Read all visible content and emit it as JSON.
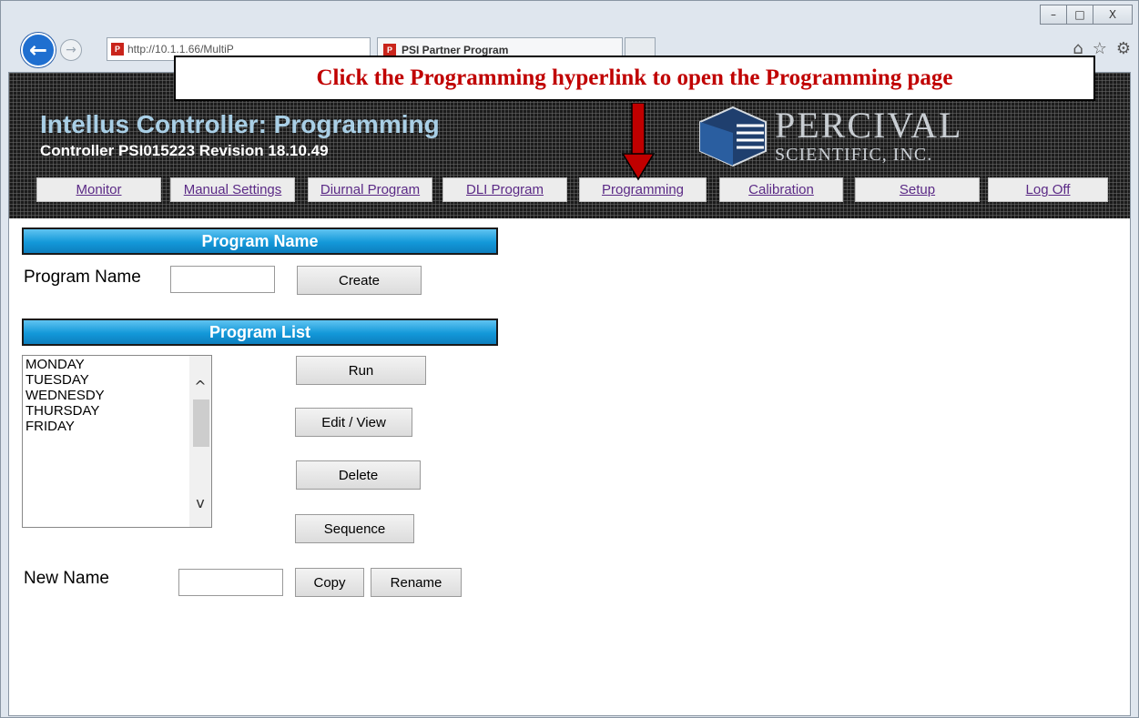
{
  "window": {
    "minimize": "–",
    "maximize": "□",
    "close": "X"
  },
  "browser": {
    "back_icon": "←",
    "forward_icon": "→",
    "address": "http://10.1.1.66/MultiP",
    "tab_title": "PSI Partner Program",
    "tool_icons": [
      "home-icon",
      "star-icon",
      "gear-icon"
    ]
  },
  "header": {
    "title": "Intellus Controller: Programming",
    "subtitle": "Controller PSI015223 Revision 18.10.49",
    "logo": {
      "line1": "PERCIVAL",
      "line2": "SCIENTIFIC, INC."
    }
  },
  "nav": [
    {
      "label": "Monitor"
    },
    {
      "label": "Manual Settings"
    },
    {
      "label": "Diurnal Program"
    },
    {
      "label": "DLI Program"
    },
    {
      "label": "Programming"
    },
    {
      "label": "Calibration"
    },
    {
      "label": "Setup"
    },
    {
      "label": "Log Off"
    }
  ],
  "callout": {
    "text": "Click the Programming hyperlink to open the Programming page",
    "color": "#c00000"
  },
  "program_name": {
    "section_title": "Program Name",
    "label": "Program Name",
    "input_value": "",
    "create_label": "Create"
  },
  "program_list": {
    "section_title": "Program List",
    "items": [
      "MONDAY",
      "TUESDAY",
      "WEDNESDY",
      "THURSDAY",
      "FRIDAY"
    ],
    "run_label": "Run",
    "edit_label": "Edit / View",
    "delete_label": "Delete",
    "sequence_label": "Sequence",
    "new_name_label": "New Name",
    "new_name_value": "",
    "copy_label": "Copy",
    "rename_label": "Rename"
  },
  "colors": {
    "section_bar": "#1398d9",
    "nav_link": "#5b2a86",
    "header_bg": "#1b1b1b"
  }
}
